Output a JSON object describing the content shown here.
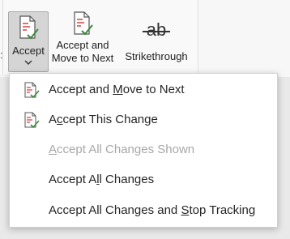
{
  "ribbon": {
    "left_stub": ":",
    "accept_label": "Accept",
    "move_next_label_1": "Accept and",
    "move_next_label_2": "Move to Next",
    "strike_label": "Strikethrough",
    "strike_glyph": "ab"
  },
  "menu": {
    "items": [
      {
        "pre": "Accept and ",
        "key": "M",
        "post": "ove to Next",
        "icon": "accept-doc-icon",
        "enabled": true
      },
      {
        "pre": "A",
        "key": "c",
        "post": "cept This Change",
        "icon": "accept-doc-icon",
        "enabled": true
      },
      {
        "pre": "",
        "key": "A",
        "post": "ccept All Changes Shown",
        "icon": "",
        "enabled": false
      },
      {
        "pre": "Accept A",
        "key": "l",
        "post": "l Changes",
        "icon": "",
        "enabled": true
      },
      {
        "pre": "Accept All Changes and ",
        "key": "S",
        "post": "top Tracking",
        "icon": "",
        "enabled": true
      }
    ]
  },
  "colors": {
    "doc_red": "#d13438",
    "check_green": "#3a8a3a"
  }
}
